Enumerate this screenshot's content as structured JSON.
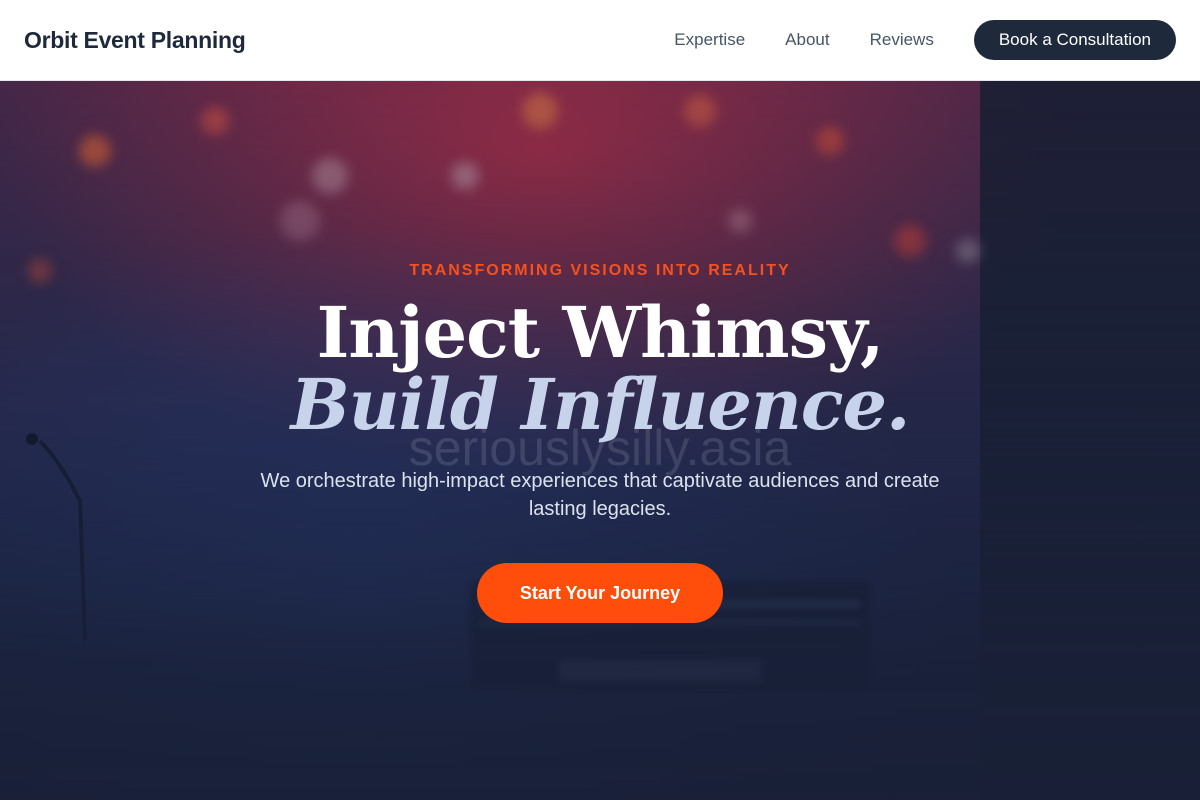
{
  "brand": {
    "name": "Orbit Event Planning"
  },
  "nav": {
    "links": [
      "Expertise",
      "About",
      "Reviews"
    ],
    "cta_label": "Book a Consultation"
  },
  "hero": {
    "eyebrow": "TRANSFORMING VISIONS INTO REALITY",
    "headline_line1": "Inject Whimsy,",
    "headline_line2": "Build Influence.",
    "watermark": "seriouslysilly.asia",
    "subheadline": "We orchestrate high-impact experiences that captivate audiences and create lasting legacies.",
    "cta_label": "Start Your Journey"
  },
  "colors": {
    "accent": "#ff4d0c",
    "eyebrow": "#f4511e",
    "navy": "#1e293b",
    "hero_overlay": "#192037"
  }
}
